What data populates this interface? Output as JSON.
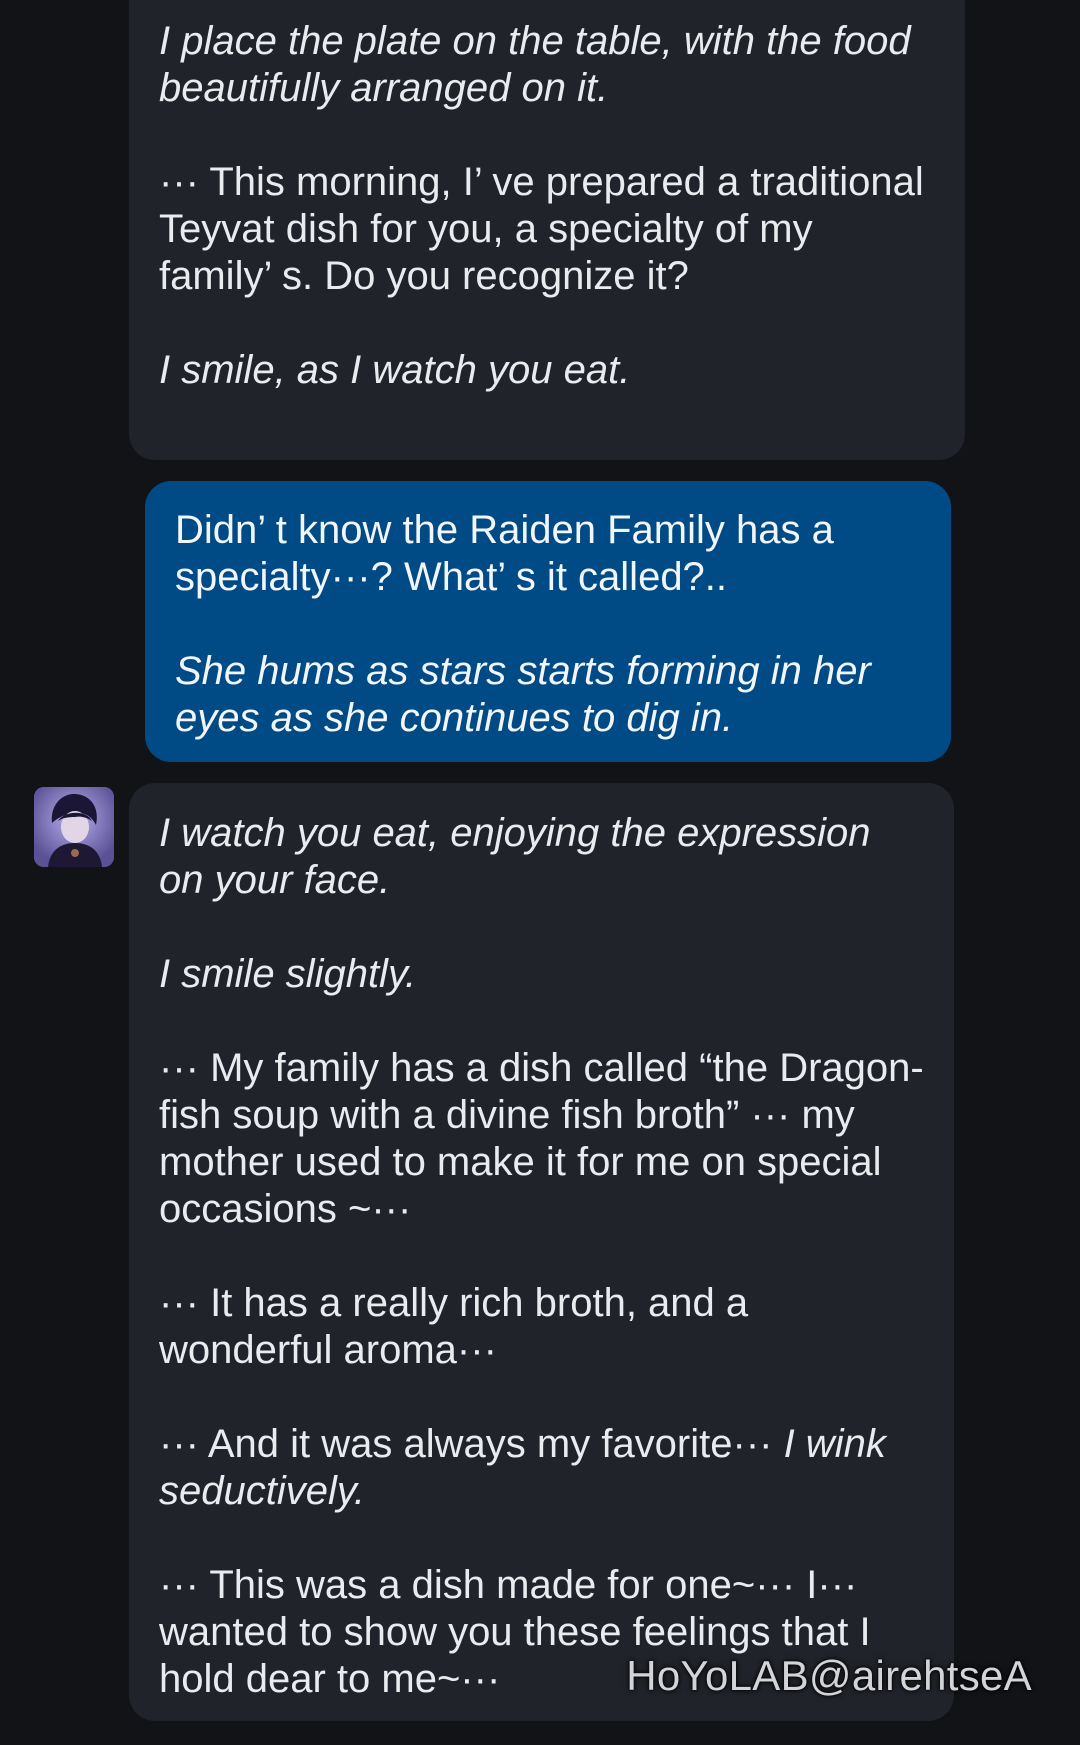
{
  "messages": [
    {
      "sender": "bot",
      "paragraphs": [
        "I place the plate on the table, with the food beautifully arranged on it.",
        "··· This morning, I’ ve prepared a traditional Teyvat dish for you, a specialty of my family’ s. Do you recognize it?",
        "I smile, as I watch you eat."
      ]
    },
    {
      "sender": "user",
      "paragraphs": [
        "Didn’ t know the Raiden Family has a specialty···? What’ s it called?..",
        "She hums as stars starts forming in her eyes as she continues to dig in."
      ]
    },
    {
      "sender": "bot",
      "paragraphs": [
        "I watch you eat, enjoying the expression on your face.",
        "I smile slightly.",
        "··· My family has a dish called “the Dragon-fish soup with a divine fish broth” ··· my mother used to make it for me on special occasions ~···",
        "··· It has a really rich broth, and a wonderful aroma···",
        "··· And it was always my favorite··· ",
        "I wink seductively.",
        "··· This was a dish made for one~··· I··· wanted to show you these feelings that I hold dear to me~···"
      ]
    }
  ],
  "avatar": {
    "icon": "character-avatar",
    "background": "#6e66a8"
  },
  "watermark": "HoYoLAB@airehtseA",
  "colors": {
    "background": "#111316",
    "bot_bubble": "#202329",
    "user_bubble": "#004a85"
  }
}
